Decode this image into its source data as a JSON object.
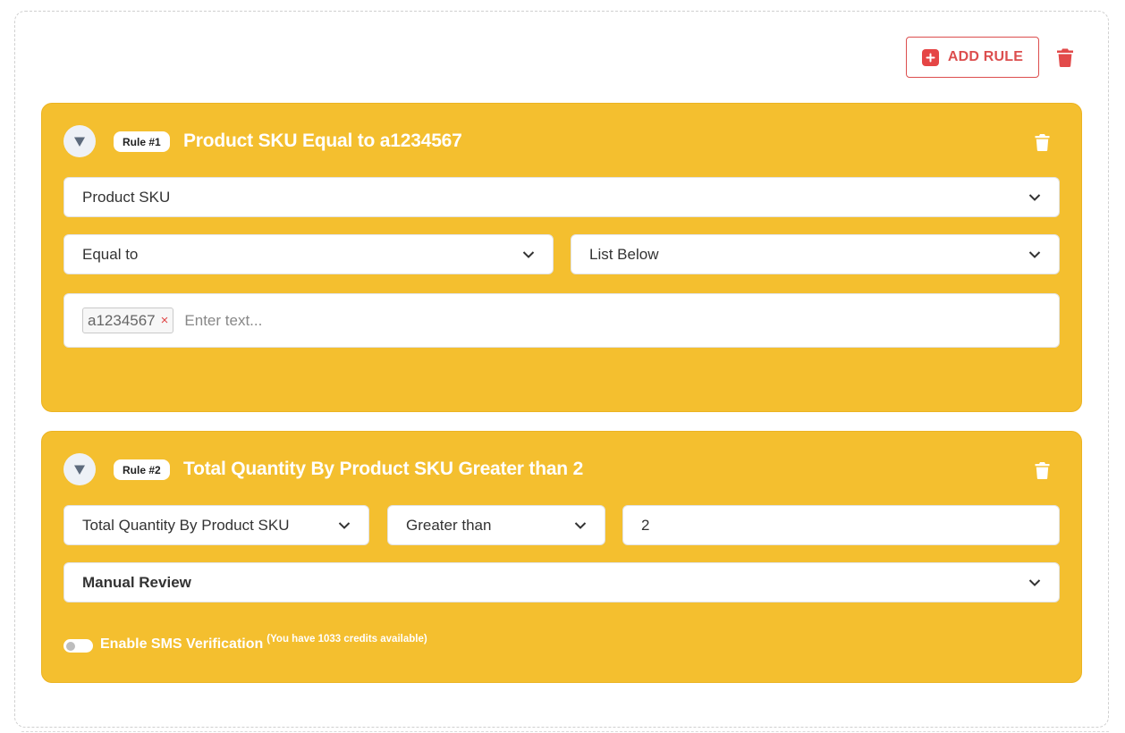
{
  "toolbar": {
    "add_rule_label": "ADD RULE",
    "icons": {
      "add": "plus-square-icon",
      "delete": "trash-icon"
    }
  },
  "colors": {
    "accent": "#dc4e4e",
    "card_bg": "#f4bf2f",
    "card_title": "#ffffff"
  },
  "rules": [
    {
      "badge": "Rule #1",
      "title": "Product SKU Equal to a1234567",
      "field": "Product SKU",
      "operator": "Equal to",
      "value_source": "List Below",
      "tags": [
        "a1234567"
      ],
      "tag_remove_symbol": "×",
      "tags_placeholder": "Enter text..."
    },
    {
      "badge": "Rule #2",
      "title": "Total Quantity By Product SKU Greater than 2",
      "field": "Total Quantity By Product SKU",
      "operator": "Greater than",
      "value": "2",
      "action": "Manual Review",
      "sms": {
        "label": "Enable SMS Verification",
        "credits": "(You have 1033 credits available)",
        "enabled": false
      }
    }
  ]
}
